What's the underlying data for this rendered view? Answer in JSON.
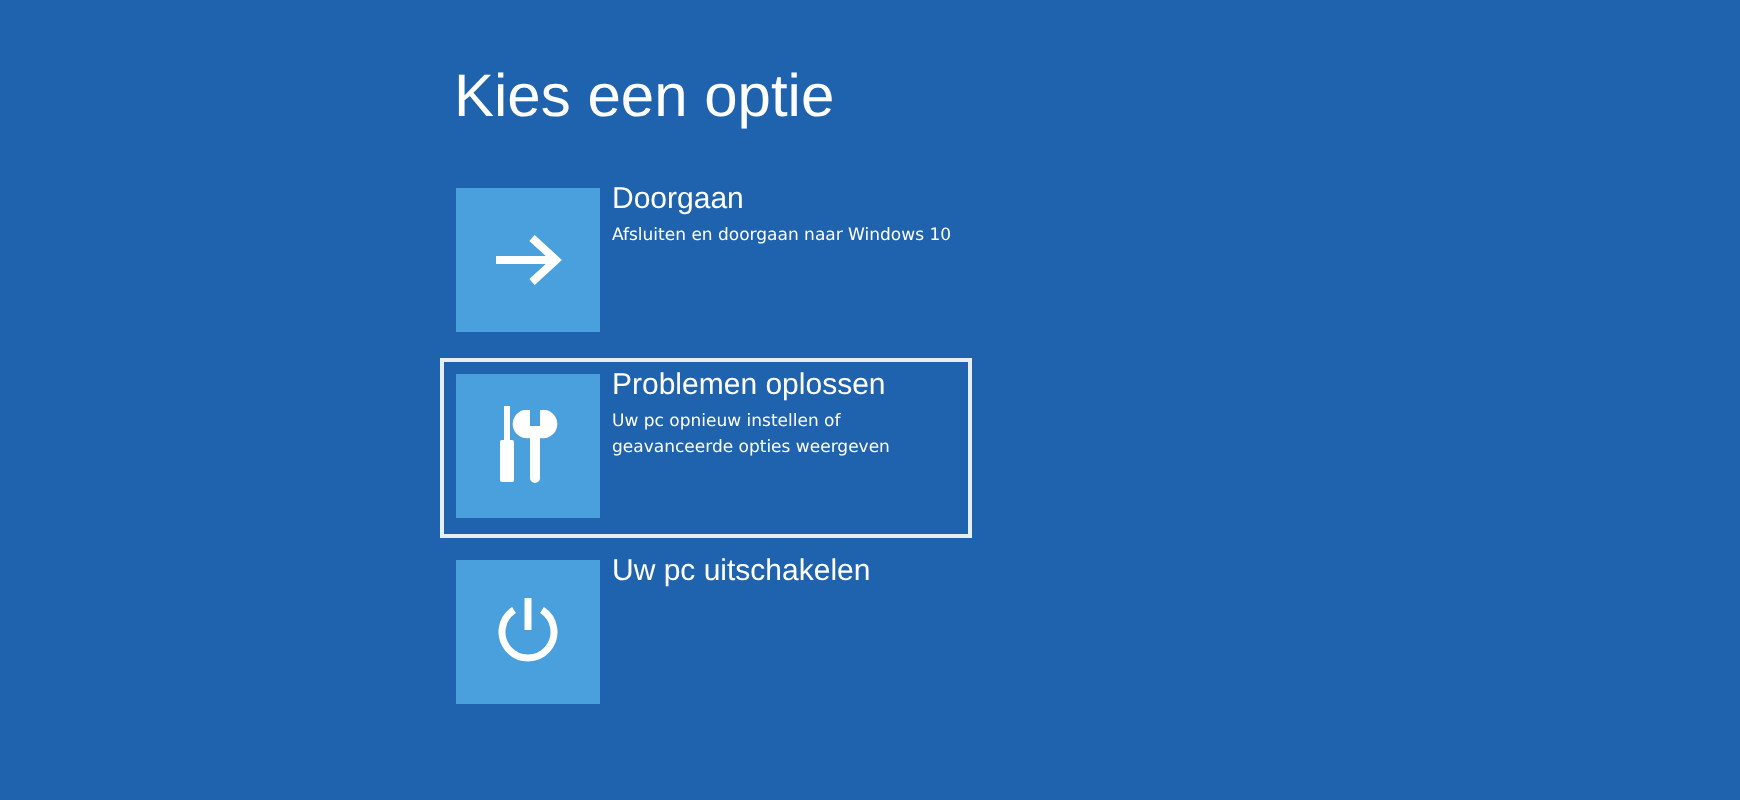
{
  "title": "Kies een optie",
  "options": [
    {
      "kind": "arrow",
      "label": "Doorgaan",
      "description": "Afsluiten en doorgaan naar Windows 10",
      "selected": false
    },
    {
      "kind": "tools",
      "label": "Problemen oplossen",
      "description": "Uw pc opnieuw instellen of geavanceerde opties weergeven",
      "selected": true
    },
    {
      "kind": "power",
      "label": "Uw pc uitschakelen",
      "selected": false
    }
  ]
}
